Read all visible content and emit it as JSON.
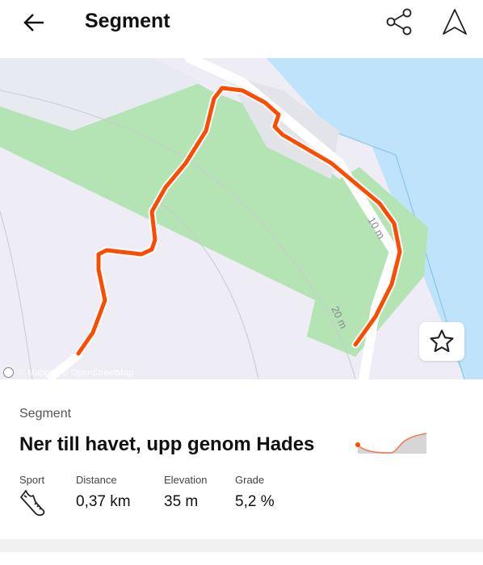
{
  "header": {
    "title": "Segment",
    "back_icon": "arrow-left-icon",
    "share_icon": "share-icon",
    "navigate_icon": "navigation-arrow-icon"
  },
  "map": {
    "attribution": "© Mapbox © OpenStreetMap",
    "contour_labels": [
      "10 m",
      "20 m"
    ],
    "route_color": "#fc4c02",
    "water_color": "#bfe3fb",
    "park_color": "#b4e3b4",
    "star_icon": "star-outline-icon"
  },
  "segment": {
    "label": "Segment",
    "name": "Ner till havet, upp genom Hades",
    "stats": [
      {
        "label": "Sport",
        "icon": "running-shoe-icon"
      },
      {
        "label": "Distance",
        "value": "0,37 km"
      },
      {
        "label": "Elevation",
        "value": "35 m"
      },
      {
        "label": "Grade",
        "value": "5,2 %"
      }
    ]
  }
}
